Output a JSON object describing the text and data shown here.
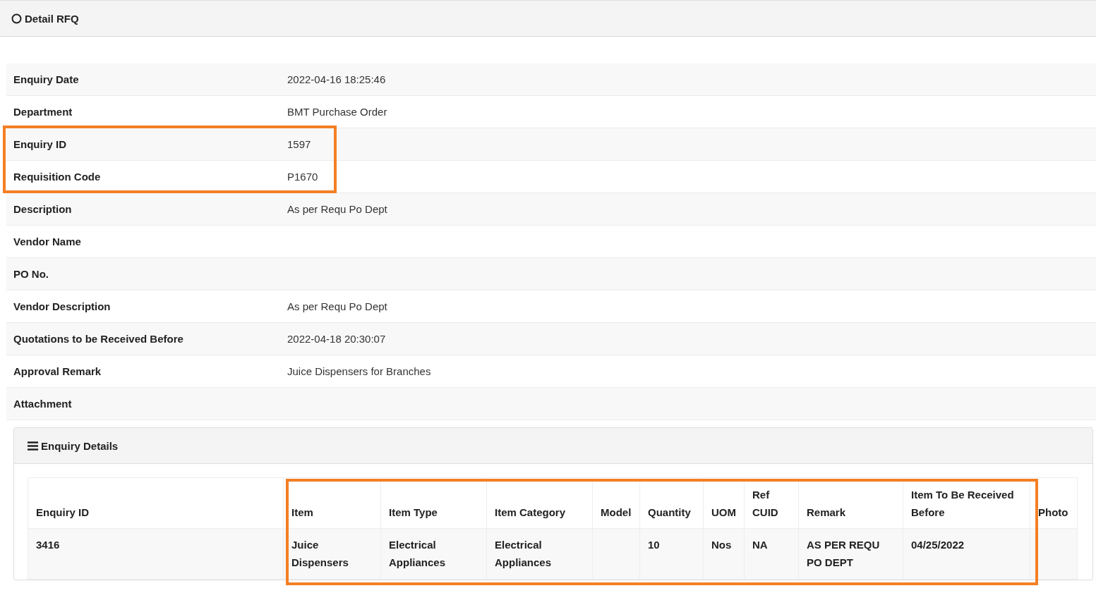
{
  "panel": {
    "title": "Detail RFQ"
  },
  "details": [
    {
      "label": "Enquiry Date",
      "value": "2022-04-16 18:25:46"
    },
    {
      "label": "Department",
      "value": "BMT Purchase Order"
    },
    {
      "label": "Enquiry ID",
      "value": "1597"
    },
    {
      "label": "Requisition Code",
      "value": "P1670"
    },
    {
      "label": "Description",
      "value": "As per Requ Po Dept"
    },
    {
      "label": "Vendor Name"
    },
    {
      "label": "PO No."
    },
    {
      "label": "Vendor Description",
      "value": "As per Requ Po Dept"
    },
    {
      "label": "Quotations to be Received Before",
      "value": "2022-04-18 20:30:07"
    },
    {
      "label": "Approval Remark",
      "value": "Juice Dispensers for Branches"
    },
    {
      "label": "Attachment"
    }
  ],
  "enquiry_details": {
    "title": "Enquiry Details",
    "table": {
      "columns": [
        "Enquiry ID",
        "Item",
        "Item Type",
        "Item Category",
        "Model",
        "Quantity",
        "UOM",
        "Ref CUID",
        "Remark",
        "Item To Be Received Before",
        "Photo"
      ],
      "rows": [
        [
          "3416",
          "Juice Dispensers",
          "Electrical Appliances",
          "Electrical Appliances",
          null,
          "10",
          "Nos",
          "NA",
          "AS PER REQU PO DEPT",
          "04/25/2022",
          null
        ]
      ]
    }
  }
}
